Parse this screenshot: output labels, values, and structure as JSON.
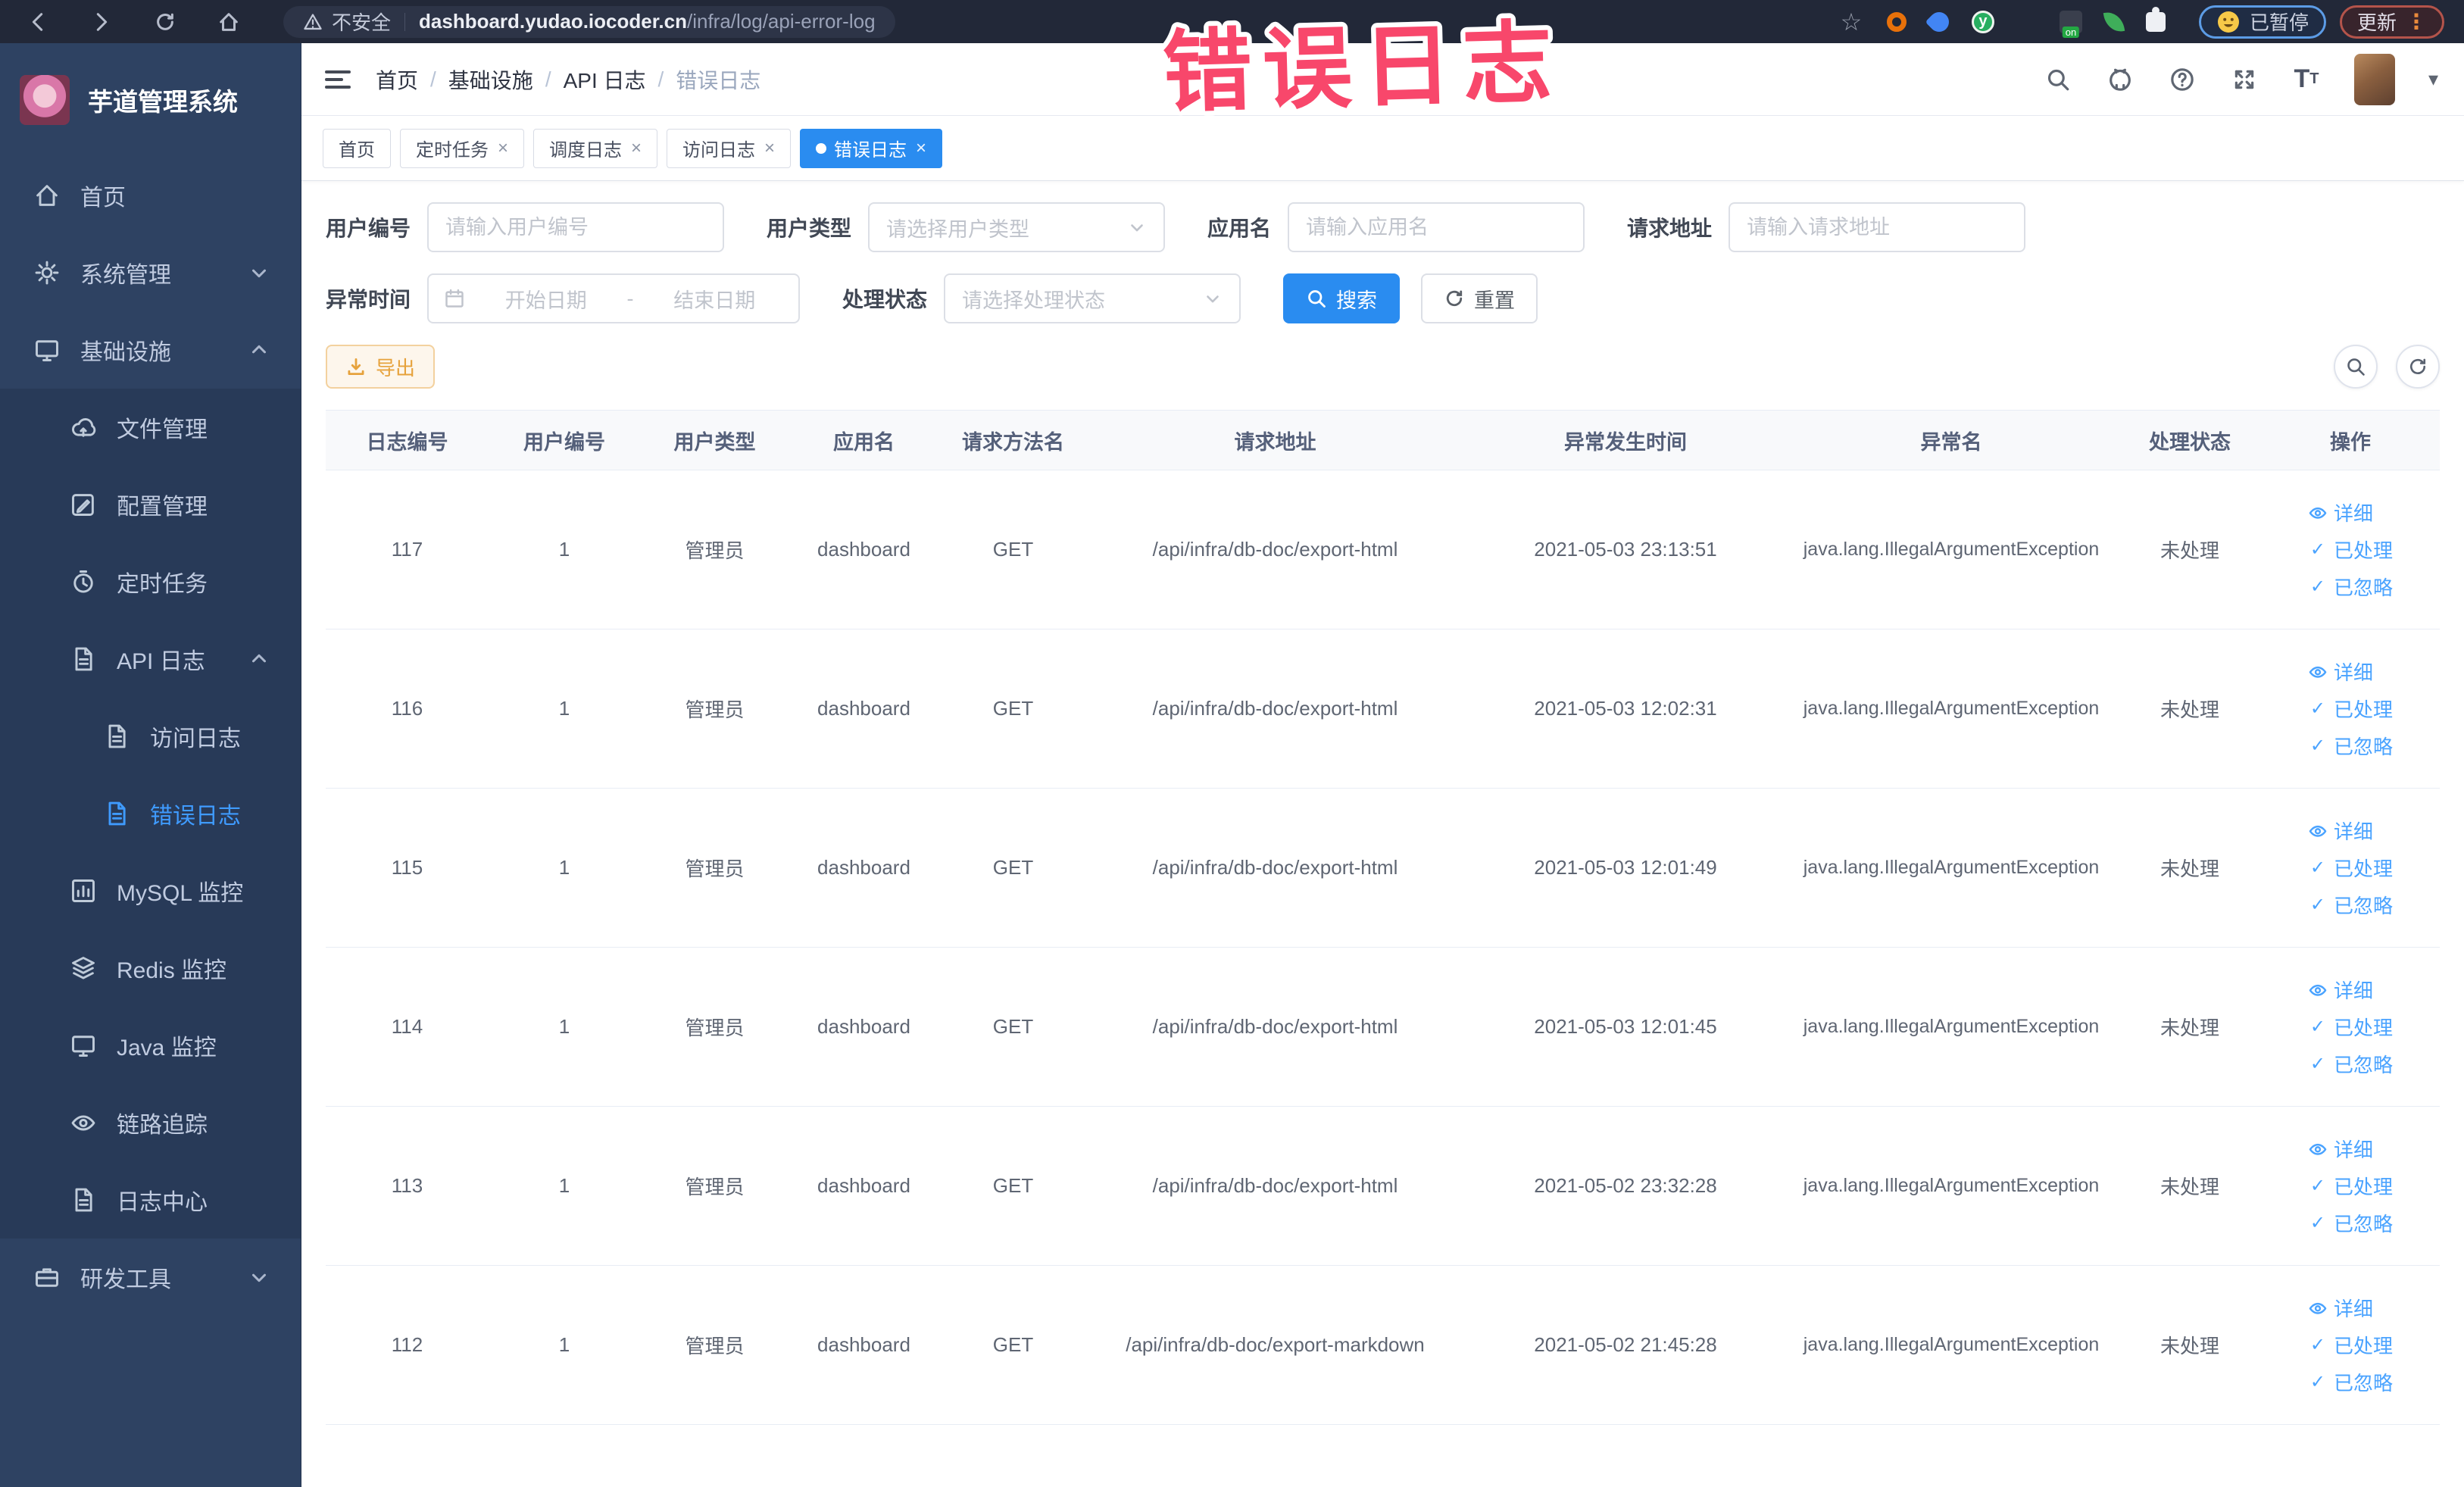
{
  "browser": {
    "security_label": "不安全",
    "url_domain": "dashboard.yudao.iocoder.cn",
    "url_path": "/infra/log/api-error-log",
    "paused_label": "已暂停",
    "update_label": "更新",
    "menu_dots": "⋮",
    "extensions": [
      "star",
      "orange-ring",
      "blue-pin",
      "green-y",
      "grid",
      "badge-on",
      "leaf",
      "puzzle"
    ]
  },
  "overlay": {
    "text": "错误日志",
    "color": "#f8476b"
  },
  "sidebar": {
    "title": "芋道管理系统",
    "items": [
      {
        "key": "home",
        "label": "首页",
        "icon": "home",
        "level": 0
      },
      {
        "key": "system",
        "label": "系统管理",
        "icon": "gear",
        "level": 0,
        "chevron": "down"
      },
      {
        "key": "infra",
        "label": "基础设施",
        "icon": "monitor",
        "level": 0,
        "chevron": "up"
      },
      {
        "key": "file",
        "label": "文件管理",
        "icon": "cloud-upload",
        "level": 1,
        "group": true
      },
      {
        "key": "config",
        "label": "配置管理",
        "icon": "edit",
        "level": 1,
        "group": true
      },
      {
        "key": "job",
        "label": "定时任务",
        "icon": "timer",
        "level": 1,
        "group": true
      },
      {
        "key": "api-log",
        "label": "API 日志",
        "icon": "document",
        "level": 1,
        "chevron": "up",
        "group": true
      },
      {
        "key": "access-log",
        "label": "访问日志",
        "icon": "document",
        "level": 2,
        "group": true
      },
      {
        "key": "error-log",
        "label": "错误日志",
        "icon": "document",
        "level": 2,
        "group": true,
        "active": true
      },
      {
        "key": "mysql",
        "label": "MySQL 监控",
        "icon": "chart",
        "level": 1,
        "group": true
      },
      {
        "key": "redis",
        "label": "Redis 监控",
        "icon": "layers",
        "level": 1,
        "group": true
      },
      {
        "key": "java",
        "label": "Java 监控",
        "icon": "monitor",
        "level": 1,
        "group": true
      },
      {
        "key": "trace",
        "label": "链路追踪",
        "icon": "eye",
        "level": 1,
        "group": true
      },
      {
        "key": "log-center",
        "label": "日志中心",
        "icon": "document",
        "level": 1,
        "group": true
      },
      {
        "key": "dev-tools",
        "label": "研发工具",
        "icon": "toolbox",
        "level": 0,
        "chevron": "down"
      }
    ]
  },
  "header": {
    "breadcrumb": [
      "首页",
      "基础设施",
      "API 日志",
      "错误日志"
    ]
  },
  "tabs": [
    {
      "key": "home",
      "label": "首页",
      "closable": false,
      "active": false
    },
    {
      "key": "job",
      "label": "定时任务",
      "closable": true,
      "active": false
    },
    {
      "key": "job-log",
      "label": "调度日志",
      "closable": true,
      "active": false
    },
    {
      "key": "access-log",
      "label": "访问日志",
      "closable": true,
      "active": false
    },
    {
      "key": "error-log",
      "label": "错误日志",
      "closable": true,
      "active": true
    }
  ],
  "filters": {
    "user_id": {
      "label": "用户编号",
      "placeholder": "请输入用户编号"
    },
    "user_type": {
      "label": "用户类型",
      "placeholder": "请选择用户类型"
    },
    "app_name": {
      "label": "应用名",
      "placeholder": "请输入应用名"
    },
    "request_url": {
      "label": "请求地址",
      "placeholder": "请输入请求地址"
    },
    "exception_time": {
      "label": "异常时间",
      "start_placeholder": "开始日期",
      "separator": "-",
      "end_placeholder": "结束日期"
    },
    "process_status": {
      "label": "处理状态",
      "placeholder": "请选择处理状态"
    },
    "search_label": "搜索",
    "reset_label": "重置"
  },
  "toolbar": {
    "export_label": "导出"
  },
  "table": {
    "columns": [
      "日志编号",
      "用户编号",
      "用户类型",
      "应用名",
      "请求方法名",
      "请求地址",
      "异常发生时间",
      "异常名",
      "处理状态",
      "操作"
    ],
    "actions": [
      "详细",
      "已处理",
      "已忽略"
    ],
    "rows": [
      {
        "id": "117",
        "user_id": "1",
        "user_type": "管理员",
        "app": "dashboard",
        "method": "GET",
        "url": "/api/infra/db-doc/export-html",
        "time": "2021-05-03 23:13:51",
        "exception": "java.lang.IllegalArgumentException",
        "status": "未处理"
      },
      {
        "id": "116",
        "user_id": "1",
        "user_type": "管理员",
        "app": "dashboard",
        "method": "GET",
        "url": "/api/infra/db-doc/export-html",
        "time": "2021-05-03 12:02:31",
        "exception": "java.lang.IllegalArgumentException",
        "status": "未处理"
      },
      {
        "id": "115",
        "user_id": "1",
        "user_type": "管理员",
        "app": "dashboard",
        "method": "GET",
        "url": "/api/infra/db-doc/export-html",
        "time": "2021-05-03 12:01:49",
        "exception": "java.lang.IllegalArgumentException",
        "status": "未处理"
      },
      {
        "id": "114",
        "user_id": "1",
        "user_type": "管理员",
        "app": "dashboard",
        "method": "GET",
        "url": "/api/infra/db-doc/export-html",
        "time": "2021-05-03 12:01:45",
        "exception": "java.lang.IllegalArgumentException",
        "status": "未处理"
      },
      {
        "id": "113",
        "user_id": "1",
        "user_type": "管理员",
        "app": "dashboard",
        "method": "GET",
        "url": "/api/infra/db-doc/export-html",
        "time": "2021-05-02 23:32:28",
        "exception": "java.lang.IllegalArgumentException",
        "status": "未处理"
      },
      {
        "id": "112",
        "user_id": "1",
        "user_type": "管理员",
        "app": "dashboard",
        "method": "GET",
        "url": "/api/infra/db-doc/export-markdown",
        "time": "2021-05-02 21:45:28",
        "exception": "java.lang.IllegalArgumentException",
        "status": "未处理"
      }
    ]
  },
  "colors": {
    "primary": "#409eff",
    "active_tab": "#2a8cf0",
    "warning": "#e6a23c",
    "sidebar": "#2e4262",
    "annotation": "#f8476b"
  }
}
